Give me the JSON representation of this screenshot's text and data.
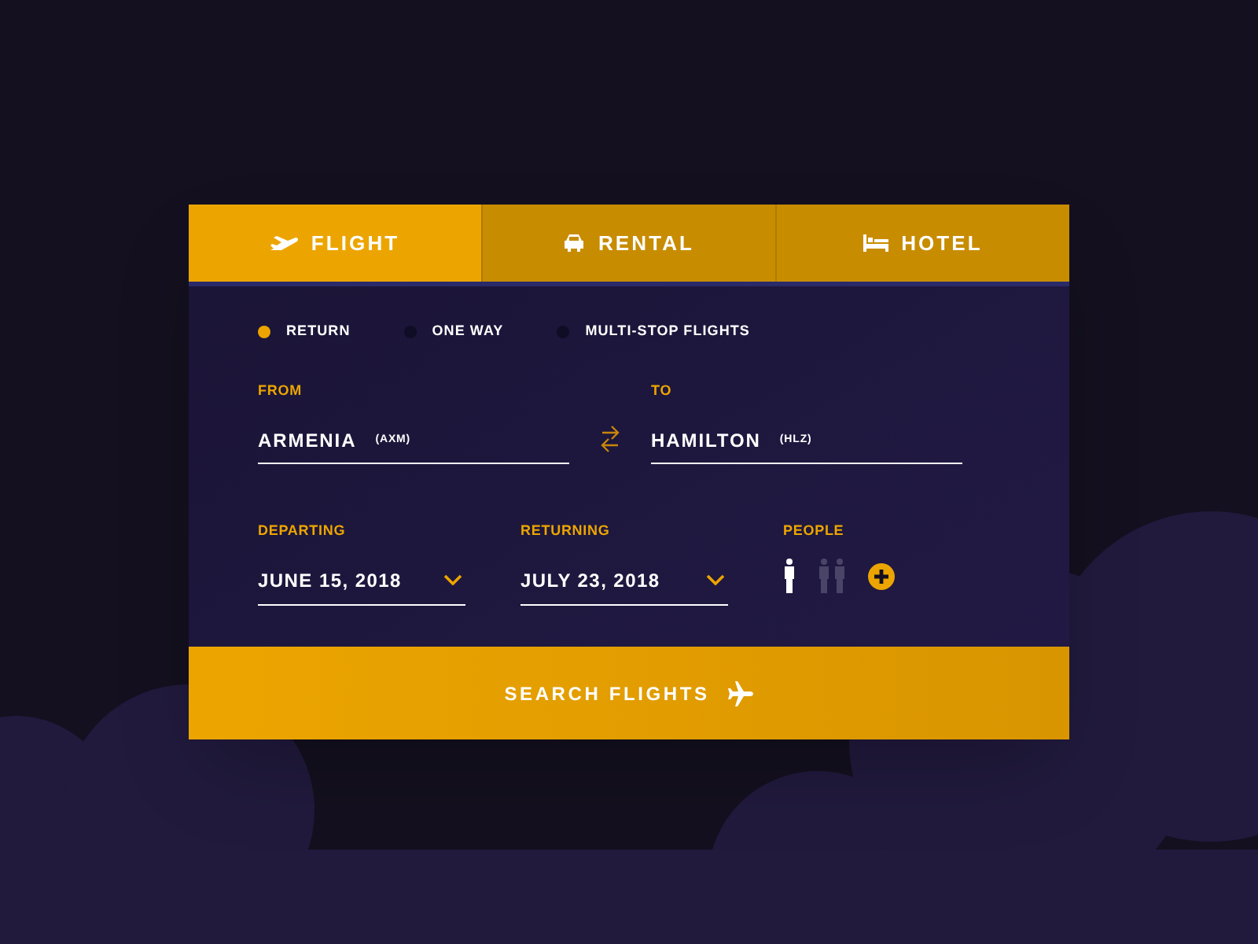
{
  "tabs": [
    {
      "label": "FLIGHT",
      "kind": "plane",
      "selected": true
    },
    {
      "label": "RENTAL",
      "kind": "car",
      "selected": false
    },
    {
      "label": "HOTEL",
      "kind": "bed",
      "selected": false
    }
  ],
  "trip_types": [
    {
      "label": "RETURN",
      "selected": true
    },
    {
      "label": "ONE WAY",
      "selected": false
    },
    {
      "label": "MULTI-STOP FLIGHTS",
      "selected": false
    }
  ],
  "from": {
    "label": "FROM",
    "city": "ARMENIA",
    "code": "(AXM)"
  },
  "to": {
    "label": "TO",
    "city": "HAMILTON",
    "code": "(HLZ)"
  },
  "departing": {
    "label": "DEPARTING",
    "value": "JUNE 15, 2018"
  },
  "returning": {
    "label": "RETURNING",
    "value": "JULY 23, 2018"
  },
  "people": {
    "label": "PEOPLE",
    "options": [
      {
        "kind": "single",
        "selected": true
      },
      {
        "kind": "pair",
        "selected": false
      }
    ]
  },
  "search_button": {
    "label": "SEARCH FLIGHTS"
  }
}
